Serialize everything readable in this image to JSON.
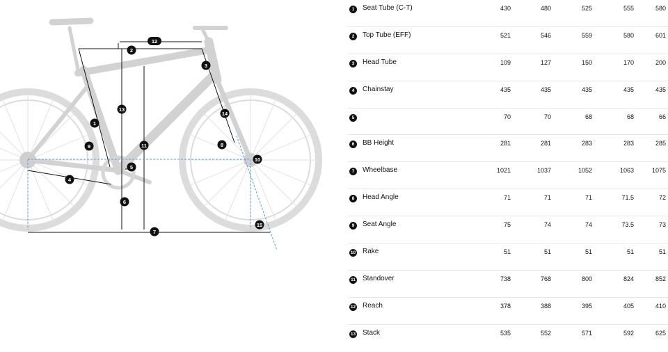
{
  "diagram": {
    "markers": [
      "1",
      "2",
      "3",
      "4",
      "5",
      "6",
      "7",
      "8",
      "9",
      "10",
      "11",
      "12",
      "13",
      "14",
      "15"
    ]
  },
  "geometry": {
    "rows": [
      {
        "num": "1",
        "label": "Seat Tube (C-T)",
        "values": [
          "430",
          "480",
          "525",
          "555",
          "580"
        ]
      },
      {
        "num": "2",
        "label": "Top Tube (EFF)",
        "values": [
          "521",
          "546",
          "559",
          "580",
          "601"
        ]
      },
      {
        "num": "3",
        "label": "Head Tube",
        "values": [
          "109",
          "127",
          "150",
          "170",
          "200"
        ]
      },
      {
        "num": "4",
        "label": "Chainstay",
        "values": [
          "435",
          "435",
          "435",
          "435",
          "435"
        ]
      },
      {
        "num": "5",
        "label": "",
        "values": [
          "70",
          "70",
          "68",
          "68",
          "66"
        ]
      },
      {
        "num": "6",
        "label": "BB Height",
        "values": [
          "281",
          "281",
          "283",
          "283",
          "285"
        ]
      },
      {
        "num": "7",
        "label": "Wheelbase",
        "values": [
          "1021",
          "1037",
          "1052",
          "1063",
          "1075"
        ]
      },
      {
        "num": "8",
        "label": "Head Angle",
        "values": [
          "71",
          "71",
          "71",
          "71.5",
          "72"
        ]
      },
      {
        "num": "9",
        "label": "Seat Angle",
        "values": [
          "75",
          "74",
          "74",
          "73.5",
          "73"
        ]
      },
      {
        "num": "10",
        "label": "Rake",
        "values": [
          "51",
          "51",
          "51",
          "51",
          "51"
        ]
      },
      {
        "num": "11",
        "label": "Standover",
        "values": [
          "738",
          "768",
          "800",
          "824",
          "852"
        ]
      },
      {
        "num": "12",
        "label": "Reach",
        "values": [
          "378",
          "388",
          "395",
          "405",
          "410"
        ]
      },
      {
        "num": "13",
        "label": "Stack",
        "values": [
          "535",
          "552",
          "571",
          "592",
          "625"
        ]
      }
    ]
  }
}
